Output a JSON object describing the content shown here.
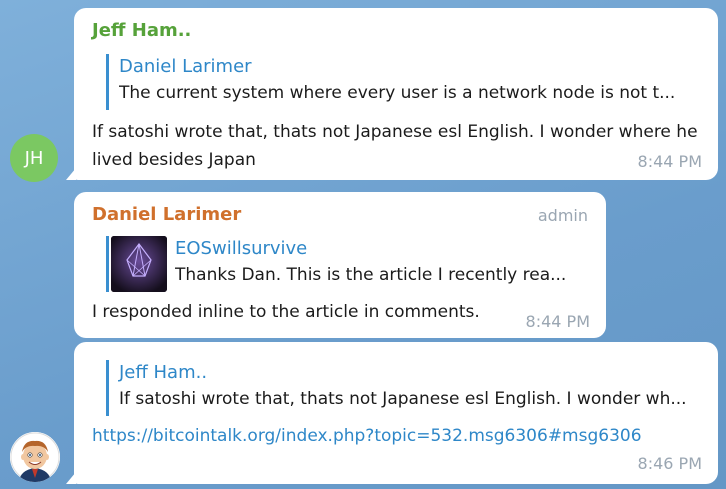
{
  "messages": [
    {
      "sender": "Jeff Ham..",
      "reply": {
        "name": "Daniel Larimer",
        "text": "The current system where every user is a network node is not t..."
      },
      "text": "If satoshi wrote that, thats not Japanese esl English. I wonder where he lived besides Japan",
      "time": "8:44 PM",
      "avatar_initials": "JH",
      "colors": {
        "sender": "#56a23a",
        "avatar": "#7bc862"
      }
    },
    {
      "sender": "Daniel Larimer",
      "badge": "admin",
      "reply": {
        "name": "EOSwillsurvive",
        "text": "Thanks Dan. This is the article I recently rea...",
        "thumbnail_icon": "eos-logo-icon"
      },
      "text": "I responded inline to the article in comments.",
      "time": "8:44 PM",
      "colors": {
        "sender": "#d0702c"
      }
    },
    {
      "reply": {
        "name": "Jeff Ham..",
        "text": "If satoshi wrote that, thats not Japanese esl English. I wonder wh..."
      },
      "link": "https://bitcointalk.org/index.php?topic=532.msg6306#msg6306",
      "time": "8:46 PM",
      "avatar_icon": "cartoon-face-avatar-icon"
    }
  ],
  "colors": {
    "background": "#6d9fcf",
    "link": "#2e87c8",
    "reply_bar": "#3a8fd0",
    "time": "#9aa6b2"
  }
}
